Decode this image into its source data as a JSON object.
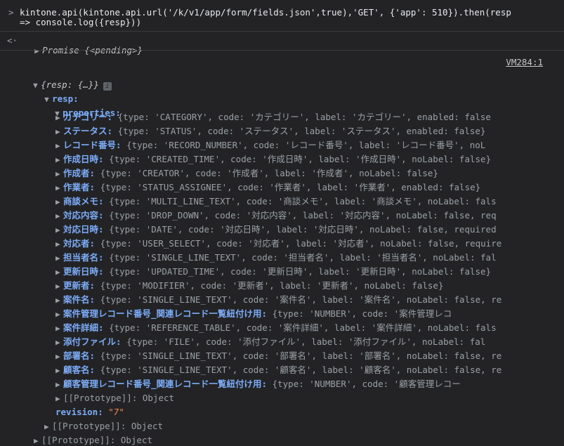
{
  "input": {
    "line1": "kintone.api(kintone.api.url('/k/v1/app/form/fields.json',true),'GET', {'app': 510}).then(resp",
    "line2": "=> console.log({resp}))"
  },
  "output": {
    "promise": "Promise {<pending>}",
    "source_link": "VM284:1",
    "resp_summary": "{resp: {…}}",
    "info_badge": "i",
    "resp_key": "resp:",
    "properties_key": "properties:",
    "fields": [
      {
        "key": "カテゴリー:",
        "value": "{type: 'CATEGORY', code: 'カテゴリー', label: 'カテゴリー', enabled: false"
      },
      {
        "key": "ステータス:",
        "value": "{type: 'STATUS', code: 'ステータス', label: 'ステータス', enabled: false}"
      },
      {
        "key": "レコード番号:",
        "value": "{type: 'RECORD_NUMBER', code: 'レコード番号', label: 'レコード番号', noL"
      },
      {
        "key": "作成日時:",
        "value": "{type: 'CREATED_TIME', code: '作成日時', label: '作成日時', noLabel: false}"
      },
      {
        "key": "作成者:",
        "value": "{type: 'CREATOR', code: '作成者', label: '作成者', noLabel: false}"
      },
      {
        "key": "作業者:",
        "value": "{type: 'STATUS_ASSIGNEE', code: '作業者', label: '作業者', enabled: false}"
      },
      {
        "key": "商談メモ:",
        "value": "{type: 'MULTI_LINE_TEXT', code: '商談メモ', label: '商談メモ', noLabel: fals"
      },
      {
        "key": "対応内容:",
        "value": "{type: 'DROP_DOWN', code: '対応内容', label: '対応内容', noLabel: false, req"
      },
      {
        "key": "対応日時:",
        "value": "{type: 'DATE', code: '対応日時', label: '対応日時', noLabel: false, required"
      },
      {
        "key": "対応者:",
        "value": "{type: 'USER_SELECT', code: '対応者', label: '対応者', noLabel: false, require"
      },
      {
        "key": "担当者名:",
        "value": "{type: 'SINGLE_LINE_TEXT', code: '担当者名', label: '担当者名', noLabel: fal"
      },
      {
        "key": "更新日時:",
        "value": "{type: 'UPDATED_TIME', code: '更新日時', label: '更新日時', noLabel: false}"
      },
      {
        "key": "更新者:",
        "value": "{type: 'MODIFIER', code: '更新者', label: '更新者', noLabel: false}"
      },
      {
        "key": "案件名:",
        "value": "{type: 'SINGLE_LINE_TEXT', code: '案件名', label: '案件名', noLabel: false, re"
      },
      {
        "key": "案件管理レコード番号_関連レコード一覧紐付け用:",
        "value": "{type: 'NUMBER', code: '案件管理レコ"
      },
      {
        "key": "案件詳細:",
        "value": "{type: 'REFERENCE_TABLE', code: '案件詳細', label: '案件詳細', noLabel: fals"
      },
      {
        "key": "添付ファイル:",
        "value": "{type: 'FILE', code: '添付ファイル', label: '添付ファイル', noLabel: fal"
      },
      {
        "key": "部署名:",
        "value": "{type: 'SINGLE_LINE_TEXT', code: '部署名', label: '部署名', noLabel: false, re"
      },
      {
        "key": "顧客名:",
        "value": "{type: 'SINGLE_LINE_TEXT', code: '顧客名', label: '顧客名', noLabel: false, re"
      },
      {
        "key": "顧客管理レコード番号_関連レコード一覧紐付け用:",
        "value": "{type: 'NUMBER', code: '顧客管理レコー"
      }
    ],
    "proto_inner": "[[Prototype]]: Object",
    "revision_key": "revision:",
    "revision_value": "\"7\"",
    "proto_resp": "[[Prototype]]: Object",
    "proto_outer": "[[Prototype]]: Object"
  }
}
